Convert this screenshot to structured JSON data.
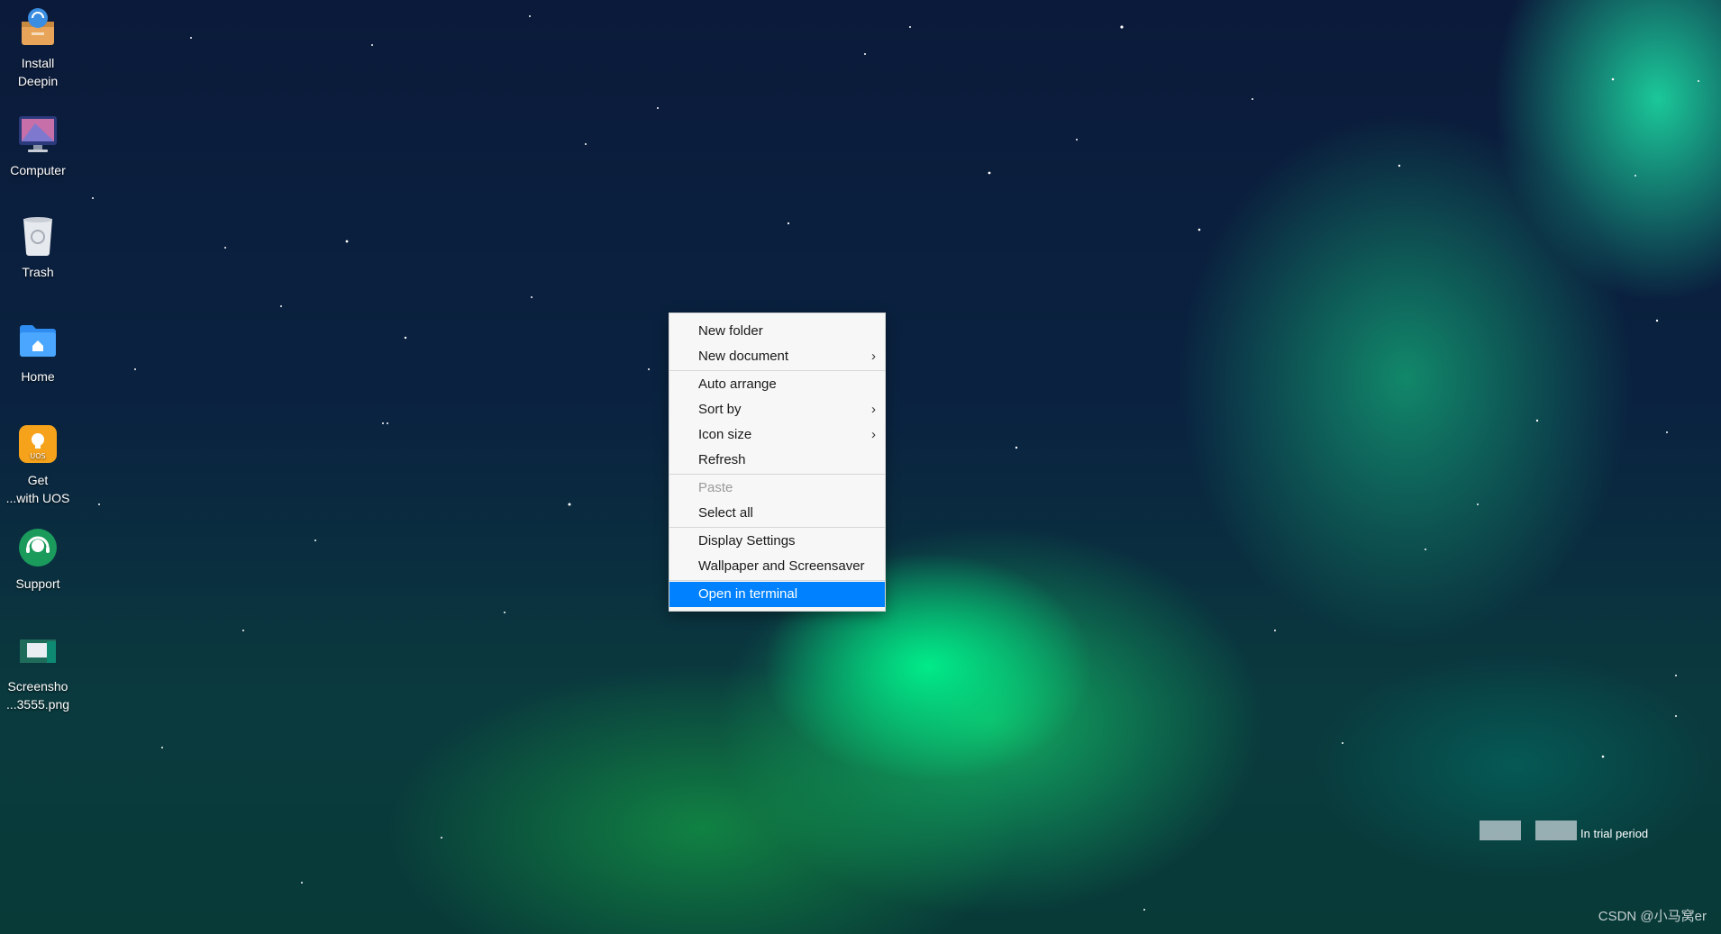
{
  "desktop": {
    "icons": [
      {
        "label": "Install\nDeepin",
        "icon": "install-box-icon"
      },
      {
        "label": "Computer",
        "icon": "computer-monitor-icon"
      },
      {
        "label": "Trash",
        "icon": "trash-bin-icon"
      },
      {
        "label": "Home",
        "icon": "home-folder-icon"
      },
      {
        "label": "Get\n...with UOS",
        "icon": "uos-lightbulb-icon"
      },
      {
        "label": "Support",
        "icon": "support-headset-icon"
      },
      {
        "label": "Screensho\n...3555.png",
        "icon": "image-file-icon"
      }
    ]
  },
  "context_menu": {
    "items": [
      {
        "label": "New folder"
      },
      {
        "label": "New document",
        "submenu": true
      },
      {
        "label": "Auto arrange"
      },
      {
        "label": "Sort by",
        "submenu": true
      },
      {
        "label": "Icon size",
        "submenu": true
      },
      {
        "label": "Refresh"
      },
      {
        "label": "Paste",
        "disabled": true
      },
      {
        "label": "Select all"
      },
      {
        "label": "Display Settings"
      },
      {
        "label": "Wallpaper and Screensaver"
      },
      {
        "label": "Open in terminal",
        "highlighted": true
      }
    ],
    "submenu_arrow": "›",
    "highlight_color": "#0081ff"
  },
  "watermark": {
    "trial_text": "In trial period",
    "csdn_text": "CSDN @小马窝er"
  }
}
